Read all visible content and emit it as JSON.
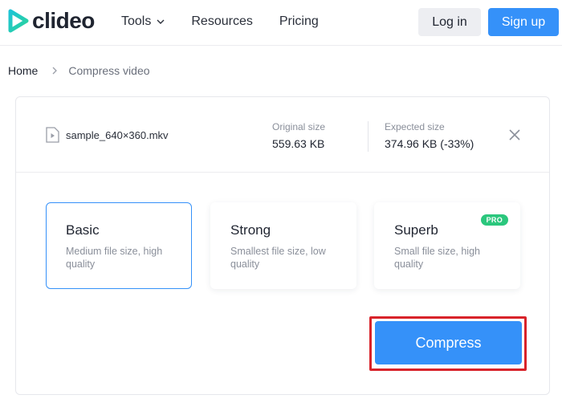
{
  "header": {
    "logo_text": "clideo",
    "nav": [
      {
        "label": "Tools"
      },
      {
        "label": "Resources"
      },
      {
        "label": "Pricing"
      }
    ],
    "login_label": "Log in",
    "signup_label": "Sign up"
  },
  "breadcrumb": {
    "home": "Home",
    "current": "Compress video"
  },
  "file": {
    "name": "sample_640×360.mkv",
    "original_label": "Original size",
    "original_value": "559.63 KB",
    "expected_label": "Expected size",
    "expected_value": "374.96 KB (-33%)"
  },
  "options": [
    {
      "title": "Basic",
      "desc": "Medium file size, high quality",
      "selected": true
    },
    {
      "title": "Strong",
      "desc": "Smallest file size, low quality",
      "selected": false
    },
    {
      "title": "Superb",
      "desc": "Small file size, high quality",
      "selected": false,
      "badge": "PRO"
    }
  ],
  "compress_label": "Compress",
  "colors": {
    "accent": "#3591f9",
    "pro_badge": "#2bc77d",
    "highlight": "#d8232a"
  }
}
